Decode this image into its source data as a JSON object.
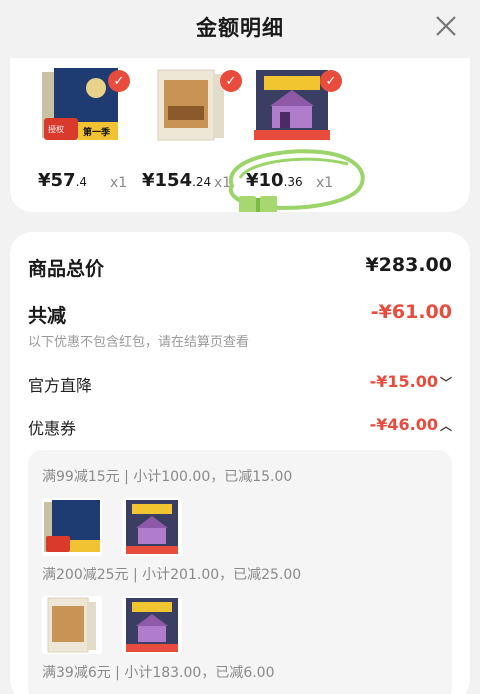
{
  "header": {
    "title": "金额明细"
  },
  "products": [
    {
      "icon": "book-set-blue-cover",
      "price_main": "¥57",
      "price_dec": ".4",
      "qty": "x1"
    },
    {
      "icon": "book-boxset-cover",
      "price_main": "¥154",
      "price_dec": ".24",
      "qty": "x1"
    },
    {
      "icon": "uhome-boardbook-cover",
      "price_main": "¥10",
      "price_dec": ".36",
      "qty": "x1"
    }
  ],
  "summary": {
    "total_label": "商品总价",
    "total_value": "¥283.00",
    "reduce_label": "共减",
    "reduce_value": "-¥61.00",
    "hint": "以下优惠不包含红包，请在结算页查看",
    "official_label": "官方直降",
    "official_value": "-¥15.00",
    "coupon_label": "优惠券",
    "coupon_value": "-¥46.00"
  },
  "coupons": [
    {
      "line": "满99减15元 | 小计100.00，已减15.00"
    },
    {
      "line": "满200减25元 | 小计201.00，已减25.00"
    },
    {
      "line": "满39减6元 | 小计183.00，已减6.00"
    }
  ],
  "colors": {
    "accent_red": "#e84c3d",
    "check_green": "#9bd56a"
  }
}
